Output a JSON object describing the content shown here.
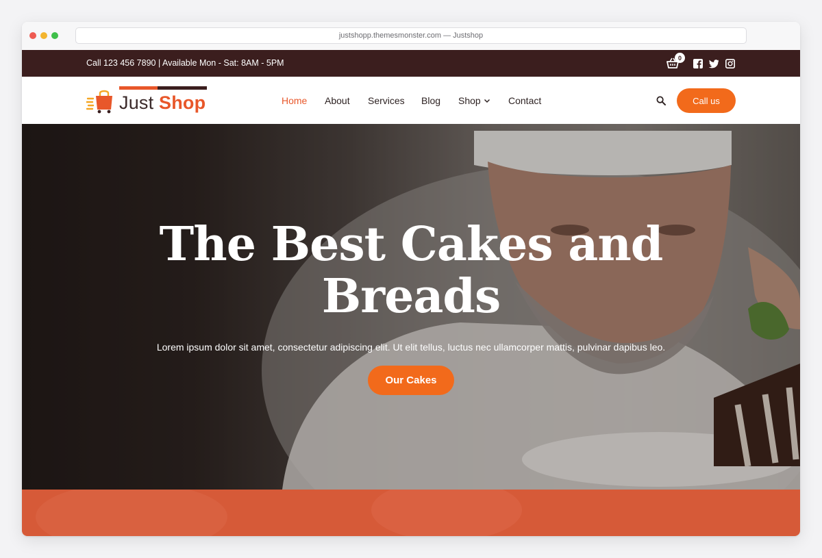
{
  "browser": {
    "url_title": "justshopp.themesmonster.com — Justshop"
  },
  "topbar": {
    "contact_info": "Call 123 456 7890 | Available Mon - Sat: 8AM - 5PM",
    "cart_count": "0",
    "social_icons": [
      "facebook-icon",
      "twitter-icon",
      "instagram-icon"
    ]
  },
  "logo": {
    "word1": "Just",
    "word2": "Shop"
  },
  "nav": {
    "items": [
      {
        "label": "Home",
        "active": true
      },
      {
        "label": "About"
      },
      {
        "label": "Services"
      },
      {
        "label": "Blog"
      },
      {
        "label": "Shop",
        "has_dropdown": true
      },
      {
        "label": "Contact"
      }
    ],
    "cta_label": "Call us"
  },
  "hero": {
    "title": "The Best Cakes and Breads",
    "subtitle": "Lorem ipsum dolor sit amet, consectetur adipiscing elit. Ut elit tellus, luctus nec ullamcorper mattis, pulvinar dapibus leo.",
    "button_label": "Our Cakes"
  },
  "colors": {
    "accent": "#f26a1b",
    "brand_orange": "#e8572a",
    "topbar_bg": "#3b1e1e",
    "band_bg": "#d65a38"
  }
}
